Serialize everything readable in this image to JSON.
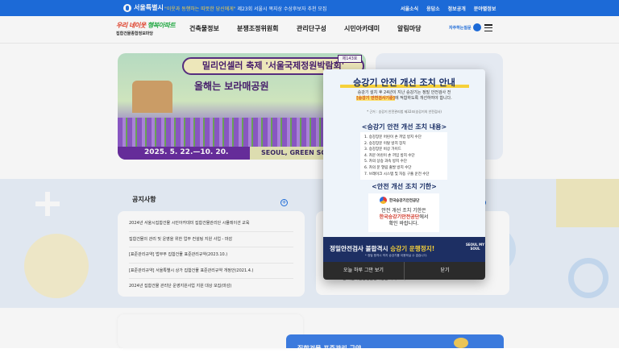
{
  "topbar": {
    "logo_text": "서울특별시",
    "notice_prefix": "\"이웃과 동행하는 따뜻한 당신에게\"",
    "notice_text": " 제23회 서울시 복지상 수상후보자 추천 모집",
    "links": [
      "서울소식",
      "응답소",
      "정보공개",
      "분야별정보"
    ]
  },
  "nav": {
    "brand_line1_a": "우리 네이웃 ",
    "brand_line1_b": "행복아파트",
    "brand_line2": "집합건물종합정보마당",
    "menu": [
      "건축물정보",
      "분쟁조정위원회",
      "관리단구성",
      "시민아카데미",
      "알림마당"
    ],
    "faq_label": "자주하는질문"
  },
  "banner": {
    "title": "밀리언셀러 축제 '서울국제정원박람회'",
    "sticker": "제143호",
    "subtitle": "올해는 보라매공원",
    "date": "2025. 5. 22.—10. 20.",
    "slogan": "SEOUL, GREEN SOUL"
  },
  "notice_section": {
    "title": "공지사항",
    "plus": "+",
    "items": [
      "2024년 서울시집합건물 시민아카데미 집합건물관리단 시뮬레이션 교육",
      "집합건물의 관리 및 운영을 위한 업무 컨설팅 지원 사업 - 마감",
      "[표준관리규약] 법무부 집합건물 표준관리규약(2023.10.)",
      "[표준관리규약] 서울특별시 상가 집합건물 표준관리규약 개정안(2021.4.)",
      "2024년 집합건물 관리단 운영지원사업 지원 대상 모집(마감)"
    ],
    "second_plus": "+",
    "second_row": "2022년 서울시집합건물관리상담 사례 교육"
  },
  "footer_card": {
    "title": "집합건물 표준관리 규약"
  },
  "popup": {
    "heading": "승강기 안전 개선 조치 안내",
    "desc_1": "승강기 설치 후 24년이 지난 승강기는 정밀 안전검사 전",
    "desc_hl": "[승강기 안전검사기준]",
    "desc_2": "에 적합하도록 개선하여야 합니다.",
    "ref": "* 근거 : 승강기 안전관리법 제32조(승강기의 안전검사)",
    "section1": "<승강기 안전 개선 조치 내용>",
    "measures": [
      "1. 승강장문 어린이 손 끼임 방지 수단",
      "2. 승강장문 이탈 방지 장치",
      "3. 승강장문 비상 가이드",
      "4. 카문 어린이 손 끼임 방지 수단",
      "5. 카의 상승 과속 방지 수단",
      "6. 카의 문 열림 출발 방지 수단",
      "7. 브레이크 시스템 및 자동 구출 운전 수단"
    ],
    "section2": "<안전 개선 조치 기한>",
    "agency": "한국승강기안전공단",
    "deadline_1": "안전 개선 조치 기한은",
    "deadline_red": "한국승강기안전공단",
    "deadline_2": "에서",
    "deadline_3": "확인 바랍니다.",
    "warning_a": "정밀안전검사 불합격시 ",
    "warning_b": "승강기 운행정지!",
    "warning_note": "* 정밀 합격시 까지 승강기를 이용하실 수 없습니다.",
    "seal": "SEOUL MY SOUL",
    "btn_hide": "오늘 하루 그만 보기",
    "btn_close": "닫기"
  }
}
